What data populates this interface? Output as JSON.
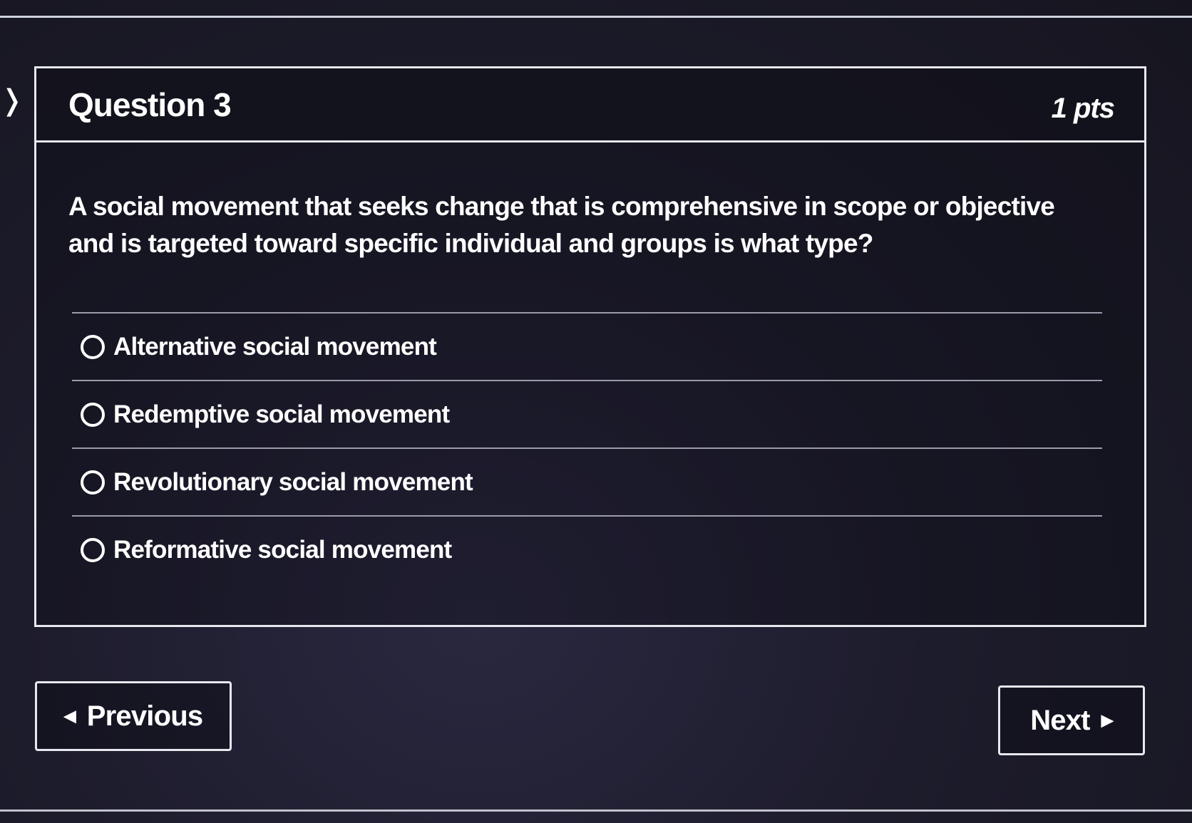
{
  "question": {
    "title": "Question 3",
    "points": "1 pts",
    "text": "A social movement that seeks change that is comprehensive in scope or objective and is targeted toward specific individual and groups is what type?",
    "answers": [
      {
        "label": "Alternative social movement",
        "selected": false
      },
      {
        "label": "Redemptive social movement",
        "selected": false
      },
      {
        "label": "Revolutionary social movement",
        "selected": false
      },
      {
        "label": "Reformative social movement",
        "selected": false
      }
    ]
  },
  "navigation": {
    "previous_label": "Previous",
    "next_label": "Next",
    "previous_icon": "triangle-left-icon",
    "next_icon": "triangle-right-icon"
  },
  "colors": {
    "background": "#1b1a2a",
    "border": "#e6e8ee",
    "text": "#ffffff"
  }
}
